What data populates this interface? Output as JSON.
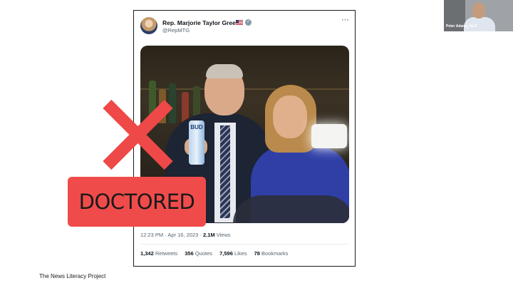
{
  "tweet": {
    "author": "Rep. Marjorie Taylor Greene",
    "handle": "@RepMTG",
    "more_icon": "⋯",
    "can_text": "BUD",
    "time": "12:23 PM · Apr 16, 2023 · ",
    "views_count": "2.1M",
    "views_label": " Views",
    "stats": {
      "retweets_count": "1,342",
      "retweets_label": "Retweets",
      "quotes_count": "356",
      "quotes_label": "Quotes",
      "likes_count": "7,596",
      "likes_label": "Likes",
      "bookmarks_count": "78",
      "bookmarks_label": "Bookmarks"
    }
  },
  "stamp": {
    "label": "DOCTORED"
  },
  "footer": {
    "credit": "The News Literacy Project"
  },
  "video": {
    "speaker_name": "Peter Adams, NLP"
  },
  "icons": [
    "flag-icon",
    "verified-icon",
    "more-icon",
    "x-mark-icon"
  ],
  "colors": {
    "stamp_red": "#f04b4b",
    "x_red": "#ee4848",
    "verified": "#829aab"
  }
}
